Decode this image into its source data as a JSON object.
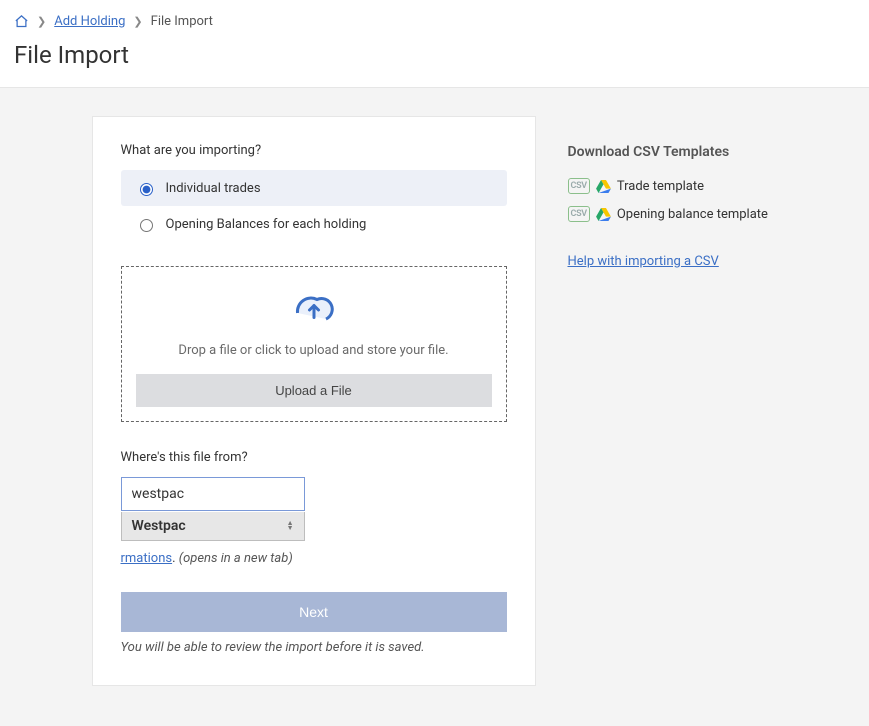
{
  "breadcrumb": {
    "add_holding": "Add Holding",
    "current": "File Import"
  },
  "page_title": "File Import",
  "card": {
    "importing_label": "What are you importing?",
    "option_trades": "Individual trades",
    "option_balances": "Opening Balances for each holding",
    "drop_text": "Drop a file or click to upload and store your file.",
    "upload_btn": "Upload a File",
    "where_label": "Where's this file from?",
    "combo_value": "westpac",
    "combo_option": "Westpac",
    "hint_link_suffix": "rmations",
    "hint_paren": "(opens in a new tab)",
    "next_btn": "Next",
    "note": "You will be able to review the import before it is saved."
  },
  "sidebar": {
    "title": "Download CSV Templates",
    "csv_label": "CSV",
    "template_trade": "Trade template",
    "template_balance": "Opening balance template",
    "help_link": "Help with importing a CSV"
  }
}
